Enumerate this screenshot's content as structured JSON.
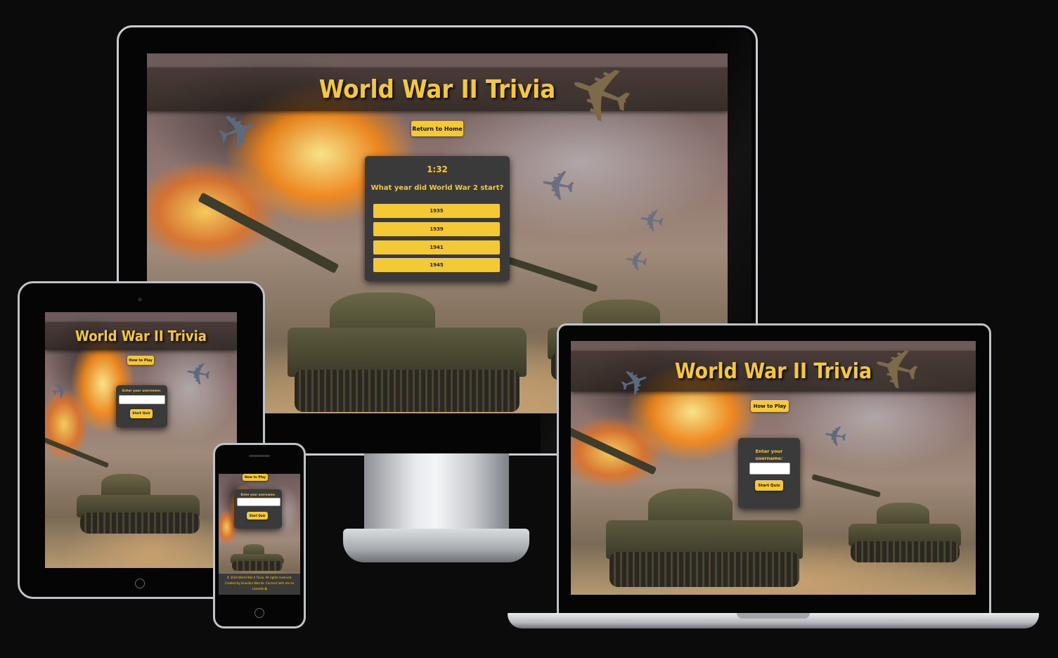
{
  "app": {
    "title": "World War II Trivia",
    "colors": {
      "accent": "#f5c935",
      "card": "#3a3a3a",
      "background": "#0b0b0b"
    }
  },
  "desktop": {
    "return_home_label": "Return to Home",
    "timer": "1:32",
    "question": "What year did World War 2 start?",
    "answers": [
      "1935",
      "1939",
      "1941",
      "1945"
    ]
  },
  "tablet": {
    "how_to_play_label": "How to Play",
    "username_label": "Enter your username:",
    "start_quiz_label": "Start Quiz"
  },
  "laptop": {
    "how_to_play_label": "How to Play",
    "username_label": "Enter your username:",
    "start_quiz_label": "Start Quiz"
  },
  "phone": {
    "how_to_play_label": "How to Play",
    "username_label": "Enter your username:",
    "start_quiz_label": "Start Quiz",
    "footer_line1": "© 2024 World War II Trivia. All rights reserved.",
    "footer_line2": "Created by Brandon Warrior. Connect with me on",
    "footer_line3": "LinkedIn ⧉"
  }
}
